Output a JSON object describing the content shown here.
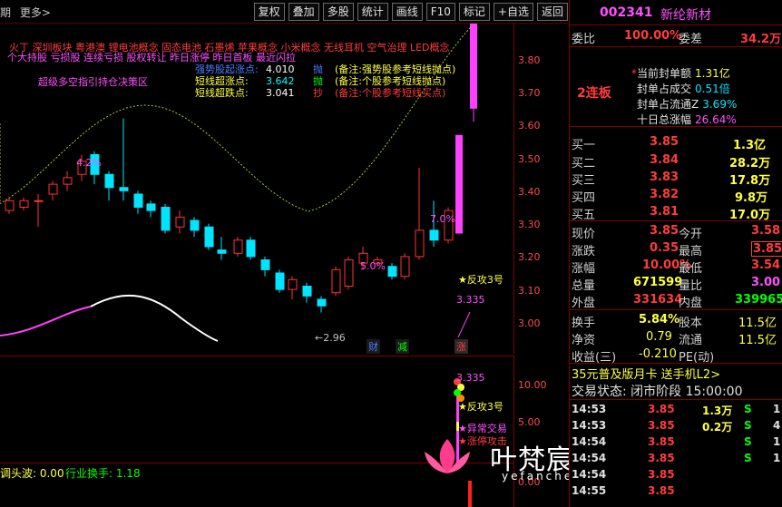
{
  "topbar": {
    "left_items": [
      "期",
      "更多>"
    ],
    "buttons": [
      "复权",
      "叠加",
      "多股",
      "统计",
      "画线",
      "F10",
      "标记",
      "+自选",
      "返回"
    ]
  },
  "chart": {
    "tags_line1": "火丁  深圳板块  粤港澳 锂电池概念 固态电池 石墨烯 苹果概念 小米概念 无线耳机 空气治理 LED概念",
    "tags_line2": "个大持股 亏损股 连续亏损 股权转让 昨日涨停 昨日首板 最近闪拉",
    "multi_label": "超级多空指引持仓决策区",
    "signals": [
      {
        "name": "强势股起涨点:",
        "value": "4.010",
        "action": "抛",
        "note": "(备注:强势股参考短线抛点)"
      },
      {
        "name": "短线超涨点:",
        "value": "3.642",
        "action": "抛",
        "note": "(备注:个股参考短线抛点)"
      },
      {
        "name": "短线超跌点:",
        "value": "3.041",
        "action": "抄",
        "note": "(备注:个股参考短线买点)"
      }
    ],
    "price_ticks": [
      "3.80",
      "3.70",
      "3.60",
      "3.50",
      "3.40",
      "3.30",
      "3.20",
      "3.10",
      "3.00"
    ],
    "pct_labels": [
      "4.2%",
      "5.0%",
      "7.0%"
    ],
    "low_label": "←2.96",
    "counter_label": "★反攻3号",
    "counter_value": "3.335",
    "badges": [
      "财",
      "减",
      "涨"
    ],
    "colors": {
      "up": "#ff3232",
      "down": "#00e5ff",
      "limit": "#ff40ff",
      "ma": "#ffffff",
      "band": "#9acd32"
    }
  },
  "lower": {
    "ticks": [
      "10.00",
      "5.00",
      "0.00"
    ],
    "value_label": "3.335",
    "labels": [
      "★反攻3号",
      "★异常交易",
      "★涨停攻击"
    ],
    "bottom_left": "调头波: 0.00",
    "bottom_right": "行业换手: 1.18"
  },
  "right": {
    "code": "002341",
    "name": "新纶新材",
    "weibi": {
      "label": "委比",
      "value": "100.00%",
      "label2": "委差",
      "value2": "34.2万"
    },
    "lianban": "2连板",
    "seal": [
      {
        "label": "当前封单额",
        "value": "1.31亿"
      },
      {
        "label": "封单占成交",
        "value": "0.51倍"
      },
      {
        "label": "封单占流通Z",
        "value": "3.69%"
      },
      {
        "label": "十日总涨幅",
        "value": "26.64%"
      }
    ],
    "bids": [
      {
        "label": "买一",
        "price": "3.85",
        "vol": "1.3亿"
      },
      {
        "label": "买二",
        "price": "3.84",
        "vol": "28.2万"
      },
      {
        "label": "买三",
        "price": "3.83",
        "vol": "17.8万"
      },
      {
        "label": "买四",
        "price": "3.82",
        "vol": "9.8万"
      },
      {
        "label": "买五",
        "price": "3.81",
        "vol": "17.0万"
      }
    ],
    "quote": [
      {
        "l1": "现价",
        "v1": "3.85",
        "l2": "今开",
        "v2": "3.58"
      },
      {
        "l1": "涨跌",
        "v1": "0.35",
        "l2": "最高",
        "v2": "3.85"
      },
      {
        "l1": "涨幅",
        "v1": "10.00%",
        "l2": "最低",
        "v2": "3.54"
      },
      {
        "l1": "总量",
        "v1": "671599",
        "l2": "量比",
        "v2": "3.00"
      },
      {
        "l1": "外盘",
        "v1": "331634",
        "l2": "内盘",
        "v2": "339965"
      }
    ],
    "fund": [
      {
        "l1": "换手",
        "v1": "5.84%",
        "l2": "股本",
        "v2": "11.5亿"
      },
      {
        "l1": "净资",
        "v1": "0.79",
        "l2": "流通",
        "v2": "11.5亿"
      },
      {
        "l1": "收益(三)",
        "v1": "-0.210",
        "l2": "PE(动)",
        "v2": ""
      }
    ],
    "promo": "35元普及版月卡 送手机L2>",
    "trade_state": "交易状态: 闭市阶段 15:00:00",
    "ticks": [
      {
        "time": "14:53",
        "price": "3.85",
        "vol": "1.3万",
        "side": "S",
        "n": "1"
      },
      {
        "time": "14:53",
        "price": "3.85",
        "vol": "0.2万",
        "side": "S",
        "n": "4"
      },
      {
        "time": "14:54",
        "price": "3.85",
        "vol": "",
        "side": "S",
        "n": "1"
      },
      {
        "time": "14:54",
        "price": "3.85",
        "vol": "",
        "side": "S",
        "n": "1"
      },
      {
        "time": "14:54",
        "price": "3.85",
        "vol": "",
        "side": "",
        "n": ""
      },
      {
        "time": "14:55",
        "price": "3.85",
        "vol": "",
        "side": "",
        "n": ""
      }
    ]
  },
  "watermark": {
    "text": "叶梵宸指标公式网",
    "url": "yefanchen.com"
  }
}
